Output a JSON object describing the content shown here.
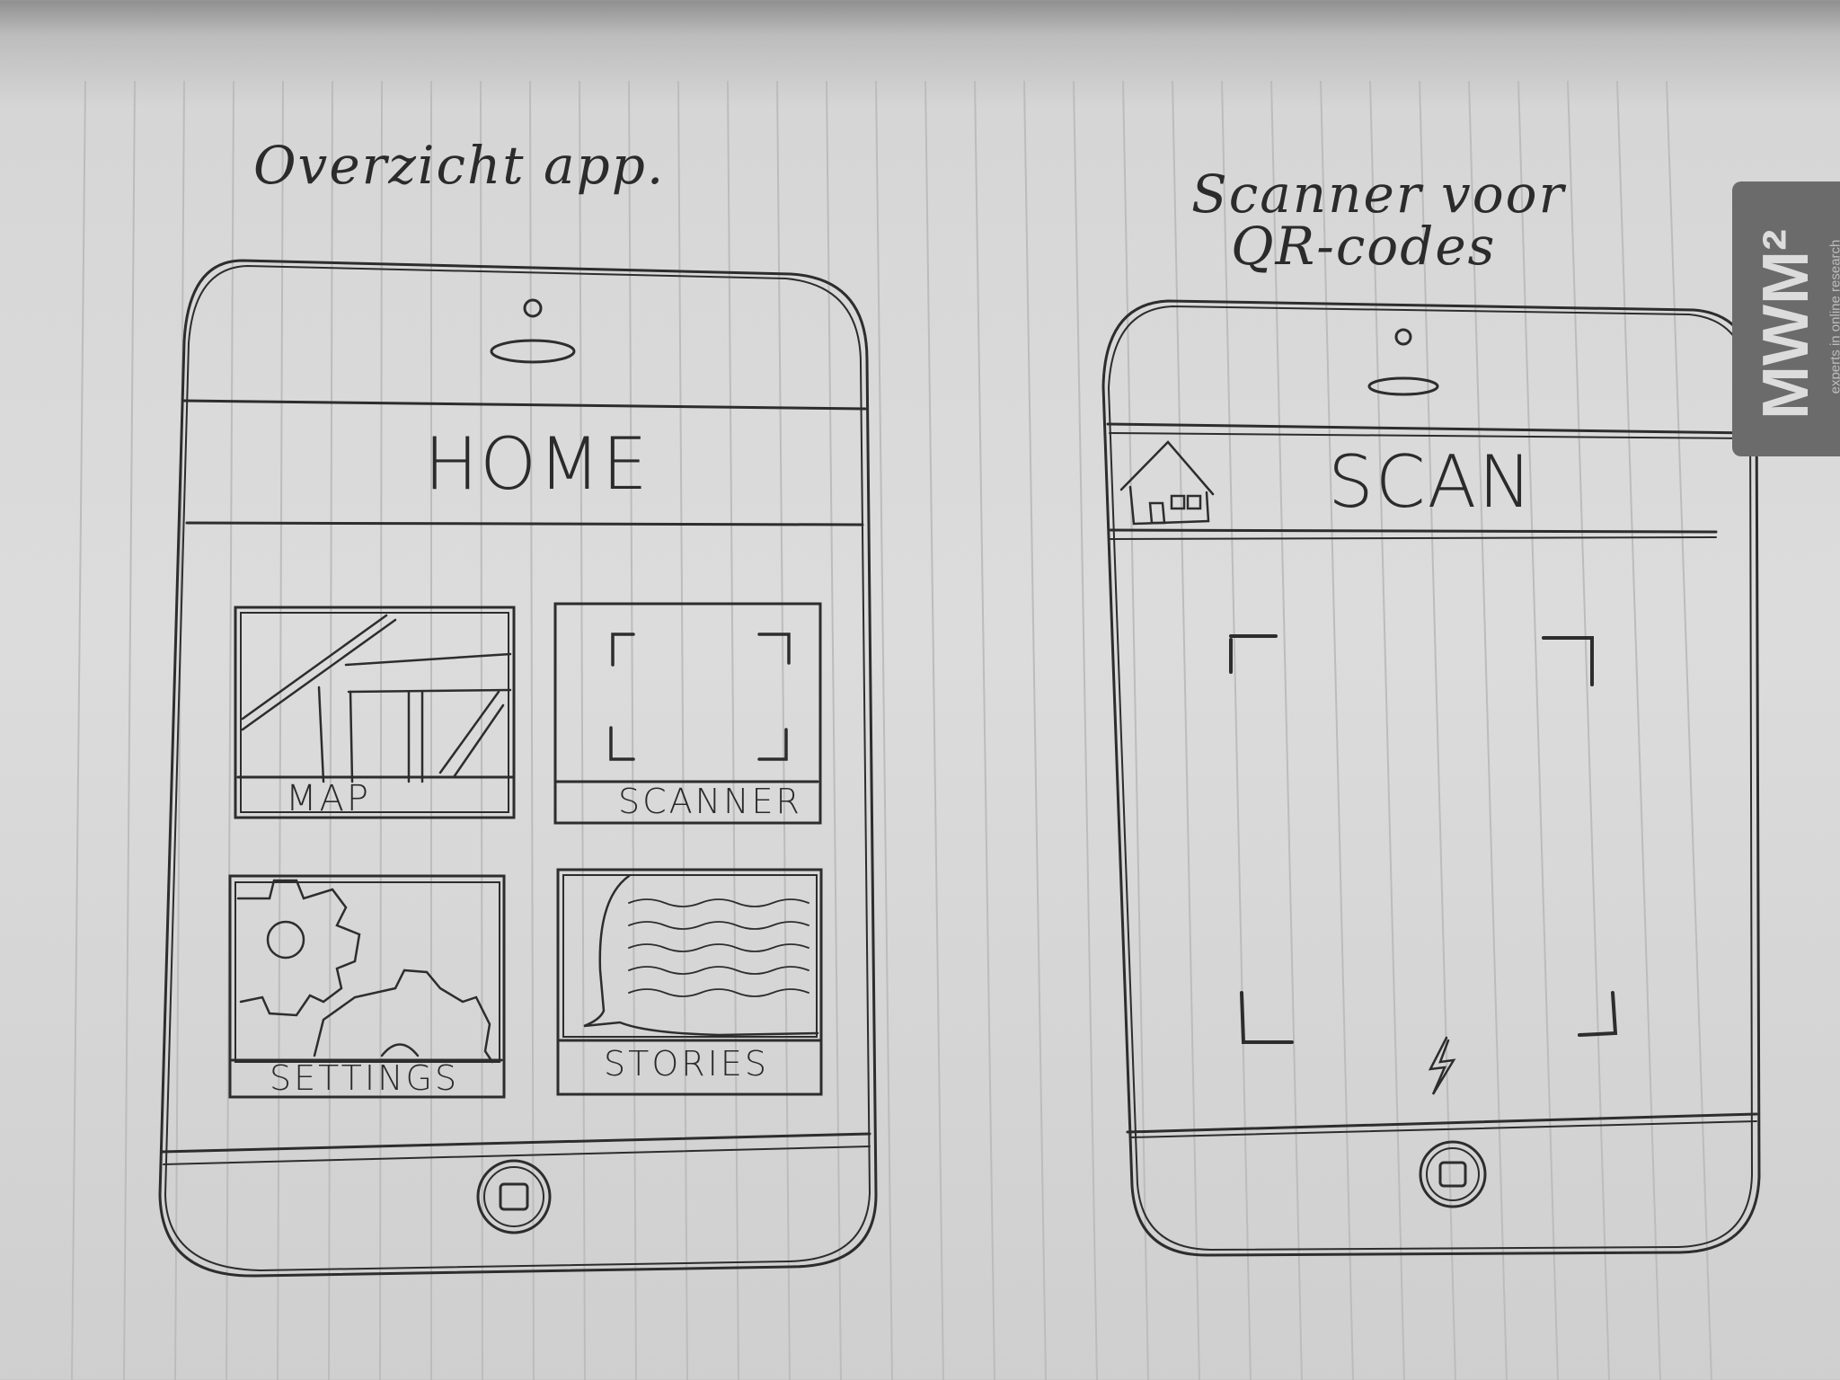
{
  "left_sketch": {
    "caption": "Overzicht app.",
    "header": "HOME",
    "tiles": [
      {
        "label": "MAP",
        "icon": "map-icon"
      },
      {
        "label": "SCANNER",
        "icon": "scanner-frame-icon"
      },
      {
        "label": "SETTINGS",
        "icon": "gears-icon"
      },
      {
        "label": "STORIES",
        "icon": "speech-bubble-icon"
      }
    ]
  },
  "right_sketch": {
    "caption_line1": "Scanner voor",
    "caption_line2": "QR-codes",
    "header": "SCAN",
    "back_icon": "house-icon",
    "flash_icon": "lightning-icon"
  },
  "logo": {
    "mark": "MWM²",
    "tagline": "experts in online research"
  }
}
